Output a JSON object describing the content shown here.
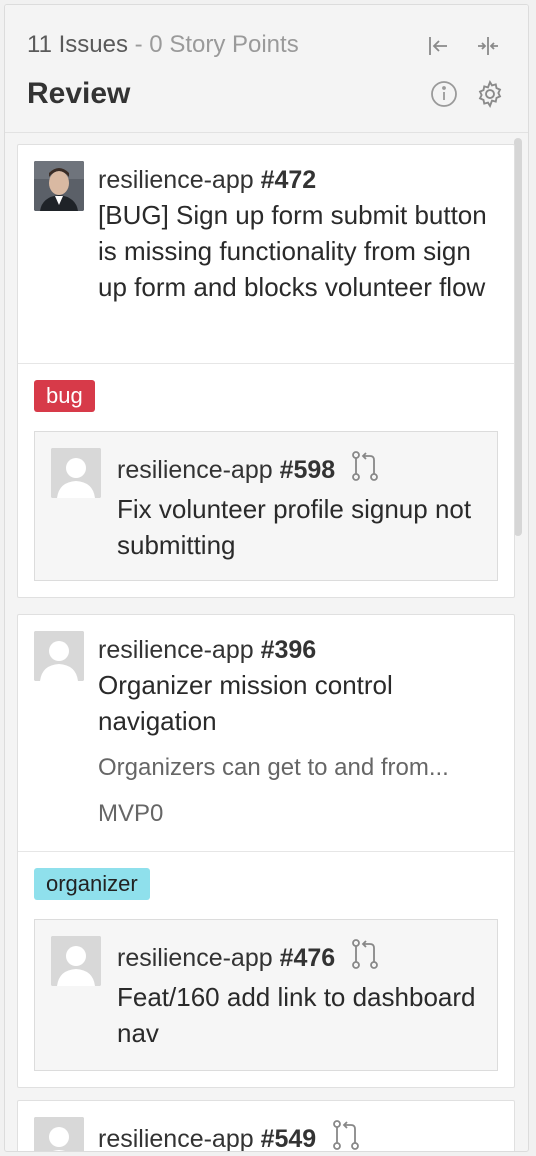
{
  "header": {
    "issue_count": "11 Issues",
    "separator": "-",
    "story_points": "0 Story Points",
    "title": "Review"
  },
  "cards": [
    {
      "repo": "resilience-app",
      "number": "#472",
      "title": "[BUG] Sign up form submit button is missing functionality from sign up form and blocks volunteer flow",
      "label": "bug",
      "label_color": "#d73a49",
      "pr": {
        "repo": "resilience-app",
        "number": "#598",
        "title": "Fix volunteer profile signup not submitting"
      }
    },
    {
      "repo": "resilience-app",
      "number": "#396",
      "title": "Organizer mission control navigation",
      "epic": "Organizers can get to and from...",
      "release": "MVP0",
      "label": "organizer",
      "label_color": "#8fe0ec",
      "pr": {
        "repo": "resilience-app",
        "number": "#476",
        "title": "Feat/160 add link to dashboard nav"
      }
    },
    {
      "repo": "resilience-app",
      "number": "#549"
    }
  ],
  "icons": {
    "collapse": "arrow-left-bar-icon",
    "expand": "compress-icon",
    "info": "info-icon",
    "settings": "gear-icon",
    "pull_request": "pull-request-icon",
    "epic": "epic-bookmark-icon",
    "release": "release-notes-icon"
  }
}
